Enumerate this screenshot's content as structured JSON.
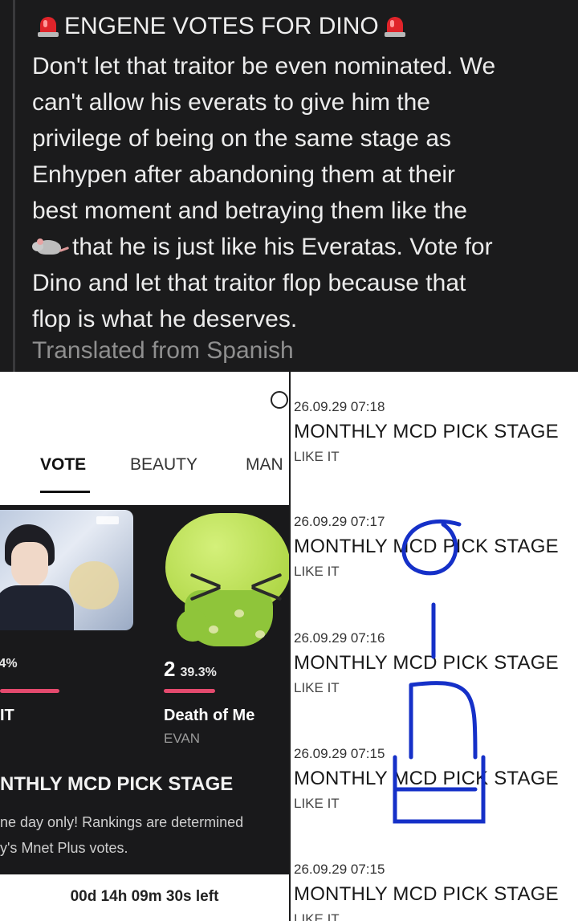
{
  "post": {
    "title": "ENGENE VOTES FOR DINO",
    "lines": [
      "Don't let that traitor be even nominated. We",
      "can't allow his everats to give him the",
      "privilege of being on the same stage as",
      "Enhypen after abandoning them at their",
      "best moment and betraying them like the"
    ],
    "rat_line": "that he is just like his Everatas. Vote for",
    "lines_after": [
      "Dino and let that traitor flop because that",
      "flop is what he deserves."
    ],
    "translated": "Translated from Spanish",
    "icons": [
      "siren-icon",
      "rat-icon"
    ]
  },
  "app": {
    "tabs": [
      "VOTE",
      "BEAUTY",
      "MAN"
    ],
    "active_tab": "VOTE",
    "left_card": {
      "pct": ".4%",
      "song": "IT"
    },
    "right_card": {
      "rank": "2",
      "pct": "39.3%",
      "song": "Death of Me",
      "artist": "EVAN"
    },
    "stage_title": "NTHLY MCD PICK STAGE",
    "desc_lines": [
      "ne day only! Rankings are determined",
      "y's Mnet Plus votes."
    ],
    "time_left": "00d 14h 09m 30s left",
    "accent": "#e44a6e"
  },
  "list": {
    "entries": [
      {
        "date": "26.09.29 07:18",
        "title": "MONTHLY MCD PICK STAGE",
        "action": "LIKE IT"
      },
      {
        "date": "26.09.29 07:17",
        "title": "MONTHLY MCD PICK STAGE",
        "action": "LIKE IT"
      },
      {
        "date": "26.09.29 07:16",
        "title": "MONTHLY MCD PICK STAGE",
        "action": "LIKE IT"
      },
      {
        "date": "26.09.29 07:15",
        "title": "MONTHLY MCD PICK STAGE",
        "action": "LIKE IT"
      },
      {
        "date": "26.09.29 07:15",
        "title": "MONTHLY MCD PICK STAGE",
        "action": "LIKE IT"
      }
    ],
    "overlay_text": "En-6",
    "overlay_color": "#1530c8"
  }
}
